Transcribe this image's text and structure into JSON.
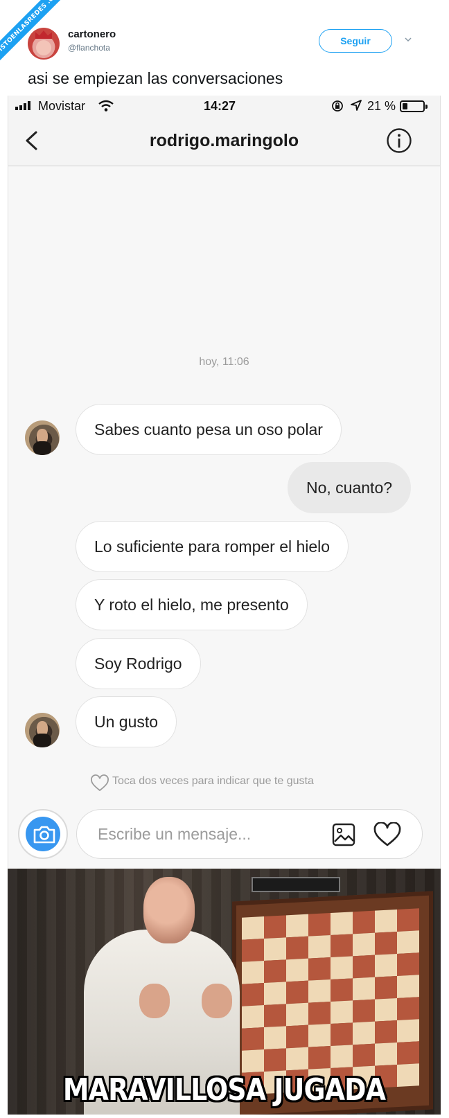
{
  "watermark": "VISTOENLASREDES .com",
  "tweet": {
    "author_name": "cartonero",
    "author_handle": "@flanchota",
    "follow_label": "Seguir",
    "text": "asi se empiezan las conversaciones"
  },
  "phone": {
    "status": {
      "carrier": "Movistar",
      "time": "14:27",
      "battery": "21 %"
    },
    "header": {
      "title": "rodrigo.maringolo"
    },
    "chat": {
      "timestamp": "hoy, 11:06",
      "messages": [
        {
          "side": "in",
          "text": "Sabes cuanto pesa un oso polar"
        },
        {
          "side": "out",
          "text": "No, cuanto?"
        },
        {
          "side": "in",
          "text": "Lo suficiente para romper el hielo"
        },
        {
          "side": "in",
          "text": "Y roto el hielo, me presento"
        },
        {
          "side": "in",
          "text": "Soy Rodrigo"
        },
        {
          "side": "in",
          "text": "Un gusto"
        }
      ],
      "like_hint": "Toca dos veces para indicar que te gusta"
    },
    "composer": {
      "placeholder": "Escribe un mensaje..."
    }
  },
  "meme": {
    "caption": "MARAVILLOSA JUGADA"
  },
  "colors": {
    "twitter_blue": "#1da1f2",
    "instagram_blue": "#3897f0"
  },
  "icons": [
    "signal-icon",
    "wifi-icon",
    "rotation-lock-icon",
    "location-icon",
    "battery-icon",
    "back-chevron-icon",
    "info-icon",
    "heart-icon",
    "camera-icon",
    "gallery-icon",
    "chevron-down-icon"
  ]
}
